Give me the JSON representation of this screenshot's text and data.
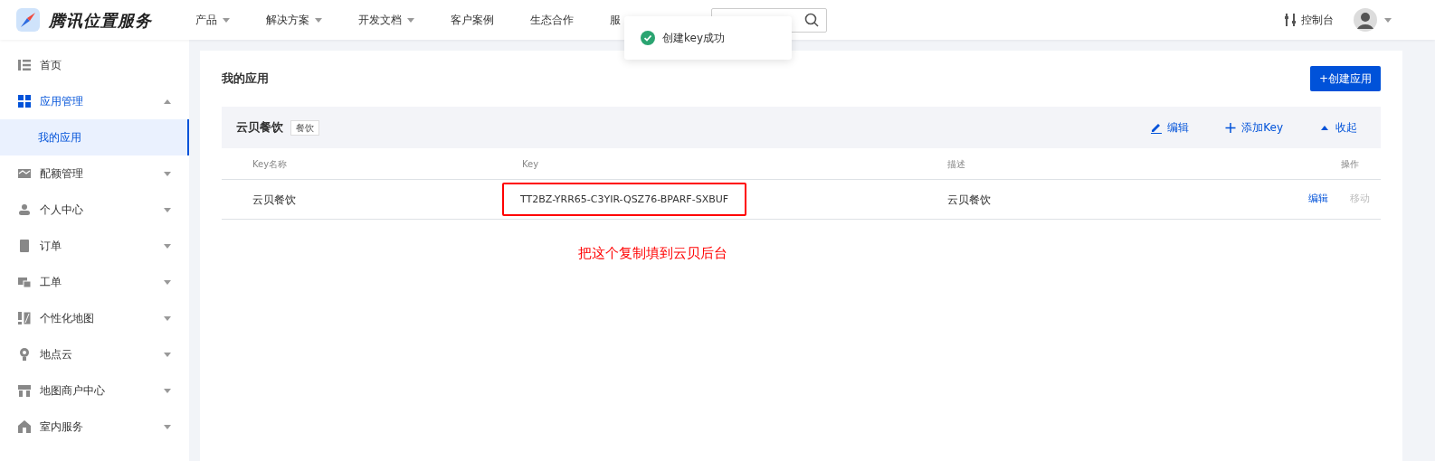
{
  "header": {
    "brand": "腾讯位置服务",
    "nav": [
      {
        "label": "产品",
        "has_menu": true
      },
      {
        "label": "解决方案",
        "has_menu": true
      },
      {
        "label": "开发文档",
        "has_menu": true
      },
      {
        "label": "客户案例",
        "has_menu": false
      },
      {
        "label": "生态合作",
        "has_menu": false
      },
      {
        "label": "服",
        "has_menu": false
      }
    ],
    "console": "控制台"
  },
  "toast": {
    "message": "创建key成功"
  },
  "sidebar": {
    "items": [
      {
        "label": "首页",
        "expanded": false,
        "has_arrow": false
      },
      {
        "label": "应用管理",
        "expanded": true,
        "has_arrow": true,
        "children": [
          {
            "label": "我的应用",
            "selected": true
          }
        ]
      },
      {
        "label": "配额管理",
        "expanded": false,
        "has_arrow": true
      },
      {
        "label": "个人中心",
        "expanded": false,
        "has_arrow": true
      },
      {
        "label": "订单",
        "expanded": false,
        "has_arrow": true
      },
      {
        "label": "工单",
        "expanded": false,
        "has_arrow": true
      },
      {
        "label": "个性化地图",
        "expanded": false,
        "has_arrow": true
      },
      {
        "label": "地点云",
        "expanded": false,
        "has_arrow": true
      },
      {
        "label": "地图商户中心",
        "expanded": false,
        "has_arrow": true
      },
      {
        "label": "室内服务",
        "expanded": false,
        "has_arrow": true
      }
    ]
  },
  "page": {
    "title": "我的应用",
    "create_button": "+创建应用"
  },
  "app": {
    "name": "云贝餐饮",
    "tag": "餐饮",
    "actions": [
      {
        "label": "编辑",
        "kind": "edit"
      },
      {
        "label": "添加Key",
        "kind": "add"
      },
      {
        "label": "收起",
        "kind": "collapse"
      }
    ],
    "table": {
      "columns": [
        "Key名称",
        "Key",
        "描述",
        "操作"
      ],
      "rows": [
        {
          "name": "云贝餐饮",
          "key": "TT2BZ-YRR65-C3YIR-QSZ76-BPARF-SXBUF",
          "description": "云贝餐饮",
          "actions": [
            {
              "label": "编辑",
              "disabled": false
            },
            {
              "label": "移动",
              "disabled": true
            }
          ],
          "highlighted": true
        }
      ]
    }
  },
  "annotation": {
    "text": "把这个复制填到云贝后台"
  }
}
